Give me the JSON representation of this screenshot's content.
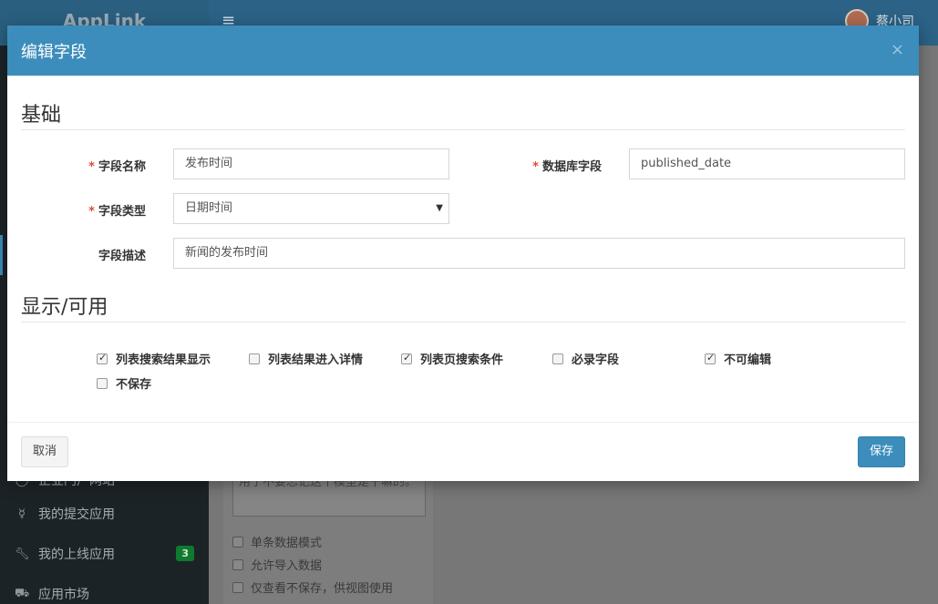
{
  "app": {
    "logo": "AppLink",
    "user_name": "蔡小司",
    "sidebar_items": [
      {
        "label": "企业门户网站",
        "icon": "circle-icon"
      },
      {
        "label": "我的提交应用",
        "icon": "bulb-icon"
      },
      {
        "label": "我的上线应用",
        "icon": "wrench-icon",
        "badge": "3"
      },
      {
        "label": "应用市场",
        "icon": "cart-icon"
      }
    ],
    "bg_textarea": "用于不要忘记这个模型是干嘛的。",
    "bg_checks": [
      "单条数据模式",
      "允许导入数据",
      "仅查看不保存，供视图使用"
    ]
  },
  "modal": {
    "title": "编辑字段",
    "close": "×",
    "sections": {
      "basic": "基础",
      "display": "显示/可用"
    },
    "fields": {
      "name": {
        "label": "字段名称",
        "value": "发布时间",
        "required": true
      },
      "db_field": {
        "label": "数据库字段",
        "value": "published_date",
        "required": true
      },
      "type": {
        "label": "字段类型",
        "value": "日期时间",
        "required": true
      },
      "desc": {
        "label": "字段描述",
        "value": "新闻的发布时间",
        "required": false
      }
    },
    "checkboxes": [
      {
        "label": "列表搜索结果显示",
        "checked": true
      },
      {
        "label": "列表结果进入详情",
        "checked": false
      },
      {
        "label": "列表页搜索条件",
        "checked": true
      },
      {
        "label": "必录字段",
        "checked": false
      },
      {
        "label": "不可编辑",
        "checked": true
      },
      {
        "label": "不保存",
        "checked": false
      }
    ],
    "buttons": {
      "cancel": "取消",
      "save": "保存"
    },
    "required_mark": "*"
  },
  "colors": {
    "primary": "#3c8dbc",
    "required": "#dd4b39"
  }
}
